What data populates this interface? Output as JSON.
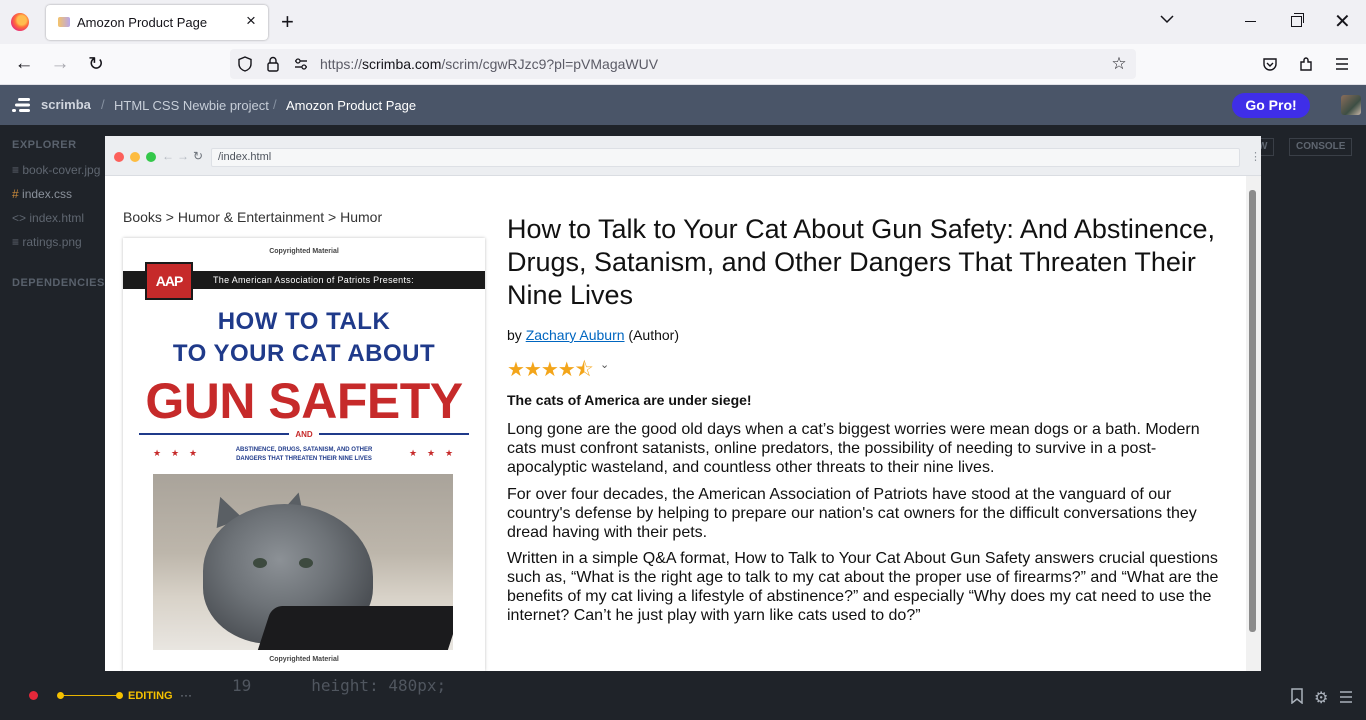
{
  "browser": {
    "tab_title": "Amozon Product Page",
    "url_prefix": "https://",
    "url_domain": "scrimba.com",
    "url_path": "/scrim/cgwRJzc9?pl=pVMagaWUV"
  },
  "scrimba": {
    "brand": "scrimba",
    "crumbs": [
      "HTML CSS Newbie project",
      "Amozon Product Page"
    ],
    "go_pro": "Go Pro!"
  },
  "editor": {
    "explorer_label": "EXPLORER",
    "files": [
      "book-cover.jpg",
      "index.css",
      "index.html",
      "ratings.png"
    ],
    "dependencies_label": "DEPENDENCIES",
    "panel_buttons": [
      "W",
      "CONSOLE"
    ],
    "code_line_number": "19",
    "code_line_text": "height: 480px;",
    "status": "EDITING"
  },
  "preview": {
    "url": "/index.html",
    "breadcrumbs": "Books > Humor & Entertainment > Humor",
    "cover": {
      "copyright_top": "Copyrighted Material",
      "copyright_bottom": "Copyrighted Material",
      "logo": "AAP",
      "presents": "The American Association of Patriots Presents:",
      "line1": "HOW TO TALK",
      "line2": "TO YOUR CAT ABOUT",
      "line3": "GUN SAFETY",
      "and": "AND",
      "sub1": "ABSTINENCE, DRUGS, SATANISM, AND OTHER",
      "sub2": "DANGERS THAT THREATEN THEIR NINE LIVES"
    },
    "product": {
      "title": "How to Talk to Your Cat About Gun Safety: And Abstinence, Drugs, Satanism, and Other Dangers That Threaten Their Nine Lives",
      "by": "by",
      "author": "Zachary Auburn",
      "role": "(Author)",
      "rating": 4.5,
      "stars_glyphs": "★★★★⯪",
      "tagline": "The cats of America are under siege!",
      "paragraphs": [
        "Long gone are the good old days when a cat’s biggest worries were mean dogs or a bath. Modern cats must confront satanists, online predators, the possibility of needing to survive in a post-apocalyptic wasteland, and countless other threats to their nine lives.",
        "For over four decades, the American Association of Patriots have stood at the vanguard of our country's defense by helping to prepare our nation's cat owners for the difficult conversations they dread having with their pets.",
        "Written in a simple Q&A format, How to Talk to Your Cat About Gun Safety answers crucial questions such as, “What is the right age to talk to my cat about the proper use of firearms?” and “What are the benefits of my cat living a lifestyle of abstinence?” and especially “Why does my cat need to use the internet? Can’t he just play with yarn like cats used to do?”"
      ]
    }
  },
  "colors": {
    "scrimba_bar": "#4a5568",
    "go_pro": "#3f2ee8",
    "star": "#f3a51a",
    "link": "#0066c0",
    "cover_red": "#c62a2a",
    "cover_blue": "#1f3a8a"
  }
}
